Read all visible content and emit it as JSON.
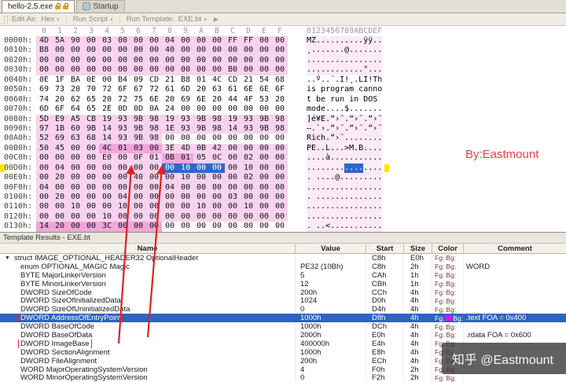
{
  "window": {
    "tabs": [
      {
        "label": "hello-2.5.exe"
      },
      {
        "label": "Startup"
      }
    ]
  },
  "toolbar": {
    "edit_as_label": "Edit As:",
    "edit_as_value": "Hex",
    "run_script_label": "Run Script",
    "run_template_label": "Run Template:",
    "run_template_value": "EXE.bt",
    "play_icon": "▶"
  },
  "hex": {
    "col_headers": [
      "0",
      "1",
      "2",
      "3",
      "4",
      "5",
      "6",
      "7",
      "8",
      "9",
      "A",
      "B",
      "C",
      "D",
      "E",
      "F"
    ],
    "ascii_header": "0123456789ABCDEF",
    "rows": [
      {
        "addr": "0000h:",
        "bytes": "4D 5A 90 00 03 00 00 00 04 00 00 00 FF FF 00 00",
        "hl": "1111111111111111",
        "ascii": "MZ..........ÿÿ..",
        "tint": 1
      },
      {
        "addr": "0010h:",
        "bytes": "B8 00 00 00 00 00 00 00 40 00 00 00 00 00 00 00",
        "hl": "1111111111111111",
        "ascii": "¸.......@.......",
        "tint": 1
      },
      {
        "addr": "0020h:",
        "bytes": "00 00 00 00 00 00 00 00 00 00 00 00 00 00 00 00",
        "hl": "1111111111111111",
        "ascii": "................",
        "tint": 1
      },
      {
        "addr": "0030h:",
        "bytes": "00 00 00 00 00 00 00 00 00 00 00 00 B0 00 00 00",
        "hl": "1111111111111111",
        "ascii": "............°...",
        "tint": 1
      },
      {
        "addr": "0040h:",
        "bytes": "0E 1F BA 0E 00 B4 09 CD 21 B8 01 4C CD 21 54 68",
        "hl": "0000000000000000",
        "ascii": "..º..´.Í!¸.LÍ!Th",
        "tint": 0
      },
      {
        "addr": "0050h:",
        "bytes": "69 73 20 70 72 6F 67 72 61 6D 20 63 61 6E 6E 6F",
        "hl": "0000000000000000",
        "ascii": "is program canno",
        "tint": 0
      },
      {
        "addr": "0060h:",
        "bytes": "74 20 62 65 20 72 75 6E 20 69 6E 20 44 4F 53 20",
        "hl": "0000000000000000",
        "ascii": "t be run in DOS ",
        "tint": 0
      },
      {
        "addr": "0070h:",
        "bytes": "6D 6F 64 65 2E 0D 0D 0A 24 00 00 00 00 00 00 00",
        "hl": "0000000000000000",
        "ascii": "mode....$.......",
        "tint": 0
      },
      {
        "addr": "0080h:",
        "bytes": "5D E9 A5 CB 19 93 9B 98 19 93 9B 98 19 93 9B 98",
        "hl": "1111111111111111",
        "ascii": "]é¥Ë.“›˜.“›˜.“›˜",
        "tint": 1
      },
      {
        "addr": "0090h:",
        "bytes": "97 1B 60 9B 14 93 9B 98 1E 93 9B 98 14 93 9B 98",
        "hl": "1111111111111111",
        "ascii": "—.`›.“›˜.“›˜.“›˜",
        "tint": 1
      },
      {
        "addr": "00A0h:",
        "bytes": "52 69 63 68 14 93 9B 98 00 00 00 00 00 00 00 00",
        "hl": "1111111100000000",
        "ascii": "Rich.“›˜........",
        "tint": 1
      },
      {
        "addr": "00B0h:",
        "bytes": "50 45 00 00 4C 01 03 00 3E 4D 0B 42 00 00 00 00",
        "hl": "1111222211111111",
        "ascii": "PE..L...>M.B....",
        "tint": 1
      },
      {
        "addr": "00C0h:",
        "bytes": "00 00 00 00 E0 00 0F 01 0B 01 05 0C 00 02 00 00",
        "hl": "1111111122111111",
        "ascii": "....à...........",
        "tint": 1
      },
      {
        "addr": "00D0h:",
        "bytes": "00 04 00 00 00 00 00 00 00 10 00 00 00 10 00 00",
        "hl": "1111111133331111",
        "ascii": "................",
        "tint": 1,
        "sel": [
          8,
          11
        ],
        "marker": 1
      },
      {
        "addr": "00E0h:",
        "bytes": "00 20 00 00 00 00 40 00 00 10 00 00 00 02 00 00",
        "hl": "1111111111111111",
        "ascii": ". ....@.........",
        "tint": 1
      },
      {
        "addr": "00F0h:",
        "bytes": "04 00 00 00 00 00 00 00 04 00 00 00 00 00 00 00",
        "hl": "1111111111111111",
        "ascii": "................",
        "tint": 1
      },
      {
        "addr": "0100h:",
        "bytes": "00 20 00 00 00 04 00 00 00 00 00 00 03 00 00 00",
        "hl": "1111111111111111",
        "ascii": ". ..............",
        "tint": 1
      },
      {
        "addr": "0110h:",
        "bytes": "00 00 10 00 00 10 00 00 00 00 10 00 00 10 00 00",
        "hl": "1111111111111111",
        "ascii": "................",
        "tint": 1
      },
      {
        "addr": "0120h:",
        "bytes": "00 00 00 00 10 00 00 00 00 00 00 00 00 00 00 00",
        "hl": "1111111111111111",
        "ascii": "................",
        "tint": 1
      },
      {
        "addr": "0130h:",
        "bytes": "14 20 00 00 3C 00 00 00 00 00 00 00 00 00 00 00",
        "hl": "2222222200000000",
        "ascii": ". ..<...........",
        "tint": 1
      }
    ]
  },
  "template": {
    "title": "Template Results - EXE.bt",
    "columns": [
      "Name",
      "Value",
      "Start",
      "Size",
      "Color",
      "Comment"
    ],
    "fg_label": "Fg:",
    "bg_label": "Bg:",
    "rows": [
      {
        "expander": "▼",
        "label": "struct IMAGE_OPTIONAL_HEADER32 OptionalHeader",
        "value": "",
        "start": "C8h",
        "size": "E0h",
        "comment": "",
        "indent": 0
      },
      {
        "label": "enum OPTIONAL_MAGIC Magic",
        "value": "PE32 (10Bh)",
        "start": "C8h",
        "size": "2h",
        "comment": "WORD",
        "indent": 1
      },
      {
        "label": "BYTE MajorLinkerVersion",
        "value": "5",
        "start": "CAh",
        "size": "1h",
        "comment": "",
        "indent": 1
      },
      {
        "label": "BYTE MinorLinkerVersion",
        "value": "12",
        "start": "CBh",
        "size": "1h",
        "comment": "",
        "indent": 1
      },
      {
        "label": "DWORD SizeOfCode",
        "value": "200h",
        "start": "CCh",
        "size": "4h",
        "comment": "",
        "indent": 1
      },
      {
        "label": "DWORD SizeOfInitializedData",
        "value": "1024",
        "start": "D0h",
        "size": "4h",
        "comment": "",
        "indent": 1
      },
      {
        "label": "DWORD SizeOfUninitializedData",
        "value": "0",
        "start": "D4h",
        "size": "4h",
        "comment": "",
        "indent": 1
      },
      {
        "label": "DWORD AddressOfEntryPoint",
        "value": "1000h",
        "start": "D8h",
        "size": "4h",
        "comment": ".text FOA = 0x400",
        "indent": 1,
        "selected": true,
        "boxed": true,
        "fg_swatch": true
      },
      {
        "label": "DWORD BaseOfCode",
        "value": "1000h",
        "start": "DCh",
        "size": "4h",
        "comment": "",
        "indent": 1
      },
      {
        "label": "DWORD BaseOfData",
        "value": "2000h",
        "start": "E0h",
        "size": "4h",
        "comment": ".rdata FOA = 0x600",
        "indent": 1
      },
      {
        "label": "DWORD ImageBase",
        "value": "400000h",
        "start": "E4h",
        "size": "4h",
        "comment": "",
        "indent": 1,
        "boxed": true
      },
      {
        "label": "DWORD SectionAlignment",
        "value": "1000h",
        "start": "E8h",
        "size": "4h",
        "comment": "",
        "indent": 1
      },
      {
        "label": "DWORD FileAlignment",
        "value": "200h",
        "start": "ECh",
        "size": "4h",
        "comment": "",
        "indent": 1
      },
      {
        "label": "WORD MajorOperatingSystemVersion",
        "value": "4",
        "start": "F0h",
        "size": "2h",
        "comment": "",
        "indent": 1
      },
      {
        "label": "WORD MinorOperatingSystemVersion",
        "value": "0",
        "start": "F2h",
        "size": "2h",
        "comment": "",
        "indent": 1
      }
    ]
  },
  "annotations": {
    "byline": "By:Eastmount",
    "watermark": "知乎 @Eastmount"
  },
  "colors": {
    "fg_swatch": "#ff00ff",
    "selection_blue": "#2f67c8",
    "selected_row_blue": "#2e63c4",
    "highlight_pink": "#f8d2ee",
    "highlight_pink_strong": "#f0a6da",
    "marker_yellow": "#ffe400",
    "accent_red": "#e02222"
  }
}
